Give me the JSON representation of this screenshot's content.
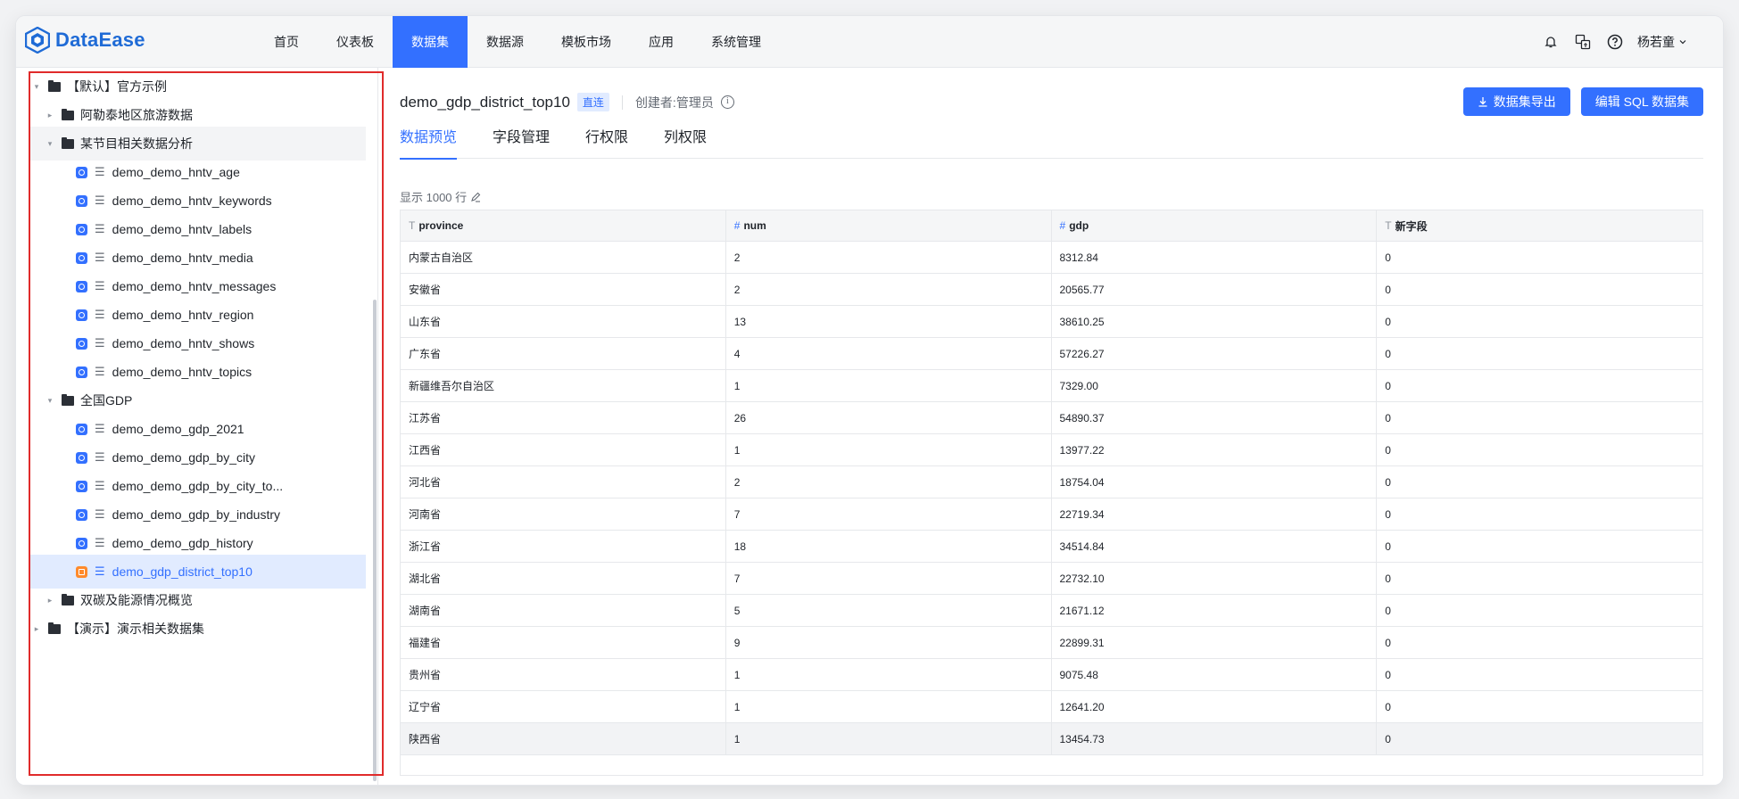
{
  "app": {
    "name": "DataEase"
  },
  "nav": {
    "items": [
      "首页",
      "仪表板",
      "数据集",
      "数据源",
      "模板市场",
      "应用",
      "系统管理"
    ],
    "active": "数据集"
  },
  "user": {
    "name": "杨若童"
  },
  "icons": {
    "notification": "bell-icon",
    "translate": "language-icon",
    "help": "help-icon"
  },
  "tree": [
    {
      "label": "【默认】官方示例",
      "kind": "folder",
      "depth": 0,
      "expanded": true
    },
    {
      "label": "阿勒泰地区旅游数据",
      "kind": "folder",
      "depth": 1,
      "expanded": false
    },
    {
      "label": "某节目相关数据分析",
      "kind": "folder",
      "depth": 1,
      "expanded": true
    },
    {
      "label": "demo_demo_hntv_age",
      "kind": "dataset",
      "depth": 2
    },
    {
      "label": "demo_demo_hntv_keywords",
      "kind": "dataset",
      "depth": 2
    },
    {
      "label": "demo_demo_hntv_labels",
      "kind": "dataset",
      "depth": 2
    },
    {
      "label": "demo_demo_hntv_media",
      "kind": "dataset",
      "depth": 2
    },
    {
      "label": "demo_demo_hntv_messages",
      "kind": "dataset",
      "depth": 2
    },
    {
      "label": "demo_demo_hntv_region",
      "kind": "dataset",
      "depth": 2
    },
    {
      "label": "demo_demo_hntv_shows",
      "kind": "dataset",
      "depth": 2
    },
    {
      "label": "demo_demo_hntv_topics",
      "kind": "dataset",
      "depth": 2
    },
    {
      "label": "全国GDP",
      "kind": "folder",
      "depth": 1,
      "expanded": true
    },
    {
      "label": "demo_demo_gdp_2021",
      "kind": "dataset",
      "depth": 2
    },
    {
      "label": "demo_demo_gdp_by_city",
      "kind": "dataset",
      "depth": 2
    },
    {
      "label": "demo_demo_gdp_by_city_to...",
      "kind": "dataset",
      "depth": 2
    },
    {
      "label": "demo_demo_gdp_by_industry",
      "kind": "dataset",
      "depth": 2
    },
    {
      "label": "demo_demo_gdp_history",
      "kind": "dataset",
      "depth": 2
    },
    {
      "label": "demo_gdp_district_top10",
      "kind": "dataset",
      "depth": 2,
      "selected": true
    },
    {
      "label": "双碳及能源情况概览",
      "kind": "folder",
      "depth": 1,
      "expanded": false
    },
    {
      "label": "【演示】演示相关数据集",
      "kind": "folder",
      "depth": 0,
      "expanded": false
    }
  ],
  "dataset": {
    "name": "demo_gdp_district_top10",
    "mode_tag": "直连",
    "creator": "创建者:管理员"
  },
  "actions": {
    "export": "数据集导出",
    "edit_sql": "编辑 SQL 数据集"
  },
  "tabs": [
    "数据预览",
    "字段管理",
    "行权限",
    "列权限"
  ],
  "active_tab": "数据预览",
  "preview": {
    "rows_label": "显示 1000 行"
  },
  "table": {
    "columns": [
      {
        "name": "province",
        "type_mark": "T"
      },
      {
        "name": "num",
        "type_mark": "#"
      },
      {
        "name": "gdp",
        "type_mark": "#"
      },
      {
        "name": "新字段",
        "type_mark": "T"
      }
    ],
    "rows": [
      [
        "内蒙古自治区",
        "2",
        "8312.84",
        "0"
      ],
      [
        "安徽省",
        "2",
        "20565.77",
        "0"
      ],
      [
        "山东省",
        "13",
        "38610.25",
        "0"
      ],
      [
        "广东省",
        "4",
        "57226.27",
        "0"
      ],
      [
        "新疆维吾尔自治区",
        "1",
        "7329.00",
        "0"
      ],
      [
        "江苏省",
        "26",
        "54890.37",
        "0"
      ],
      [
        "江西省",
        "1",
        "13977.22",
        "0"
      ],
      [
        "河北省",
        "2",
        "18754.04",
        "0"
      ],
      [
        "河南省",
        "7",
        "22719.34",
        "0"
      ],
      [
        "浙江省",
        "18",
        "34514.84",
        "0"
      ],
      [
        "湖北省",
        "7",
        "22732.10",
        "0"
      ],
      [
        "湖南省",
        "5",
        "21671.12",
        "0"
      ],
      [
        "福建省",
        "9",
        "22899.31",
        "0"
      ],
      [
        "贵州省",
        "1",
        "9075.48",
        "0"
      ],
      [
        "辽宁省",
        "1",
        "12641.20",
        "0"
      ],
      [
        "陕西省",
        "1",
        "13454.73",
        "0"
      ]
    ]
  }
}
